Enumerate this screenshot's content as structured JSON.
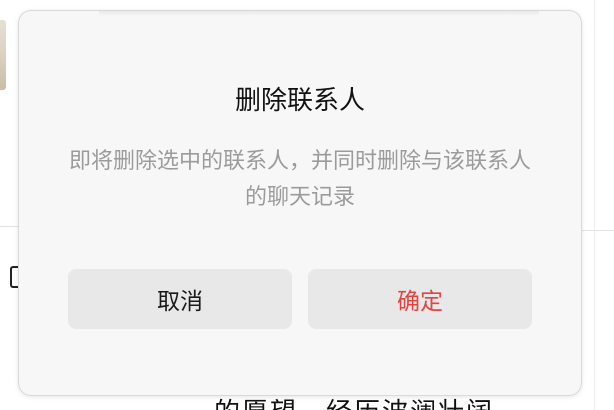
{
  "dialog": {
    "title": "删除联系人",
    "message": "即将删除选中的联系人，并同时删除与该联系人的聊天记录",
    "cancel_label": "取消",
    "confirm_label": "确定"
  },
  "background": {
    "partial_text": "的愿望，经历波澜壮阔"
  },
  "colors": {
    "confirm_text": "#e64340",
    "message_text": "#9b9b9b",
    "button_bg": "#e8e8e8",
    "dialog_bg": "#f7f7f7"
  }
}
